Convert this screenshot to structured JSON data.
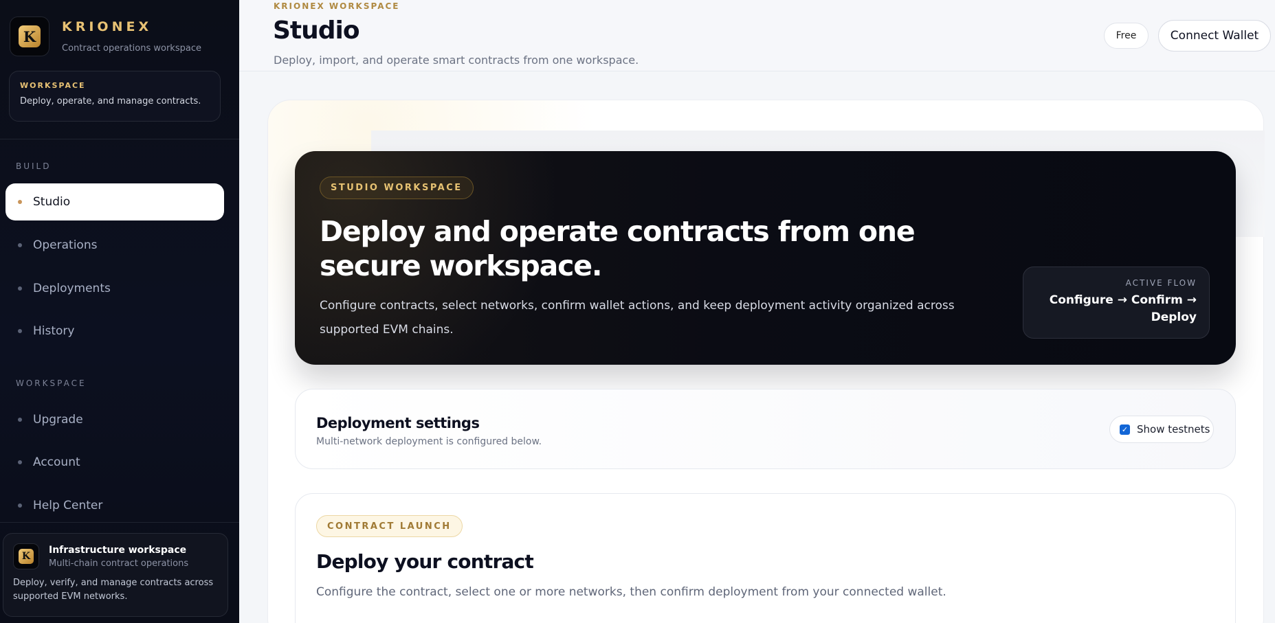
{
  "sidebar": {
    "brand": {
      "logo_letter": "K",
      "name": "KRIONEX",
      "tagline": "Contract operations workspace"
    },
    "workspace_card": {
      "title": "WORKSPACE",
      "description": "Deploy, operate, and manage contracts."
    },
    "sections": [
      {
        "label": "BUILD",
        "items": [
          {
            "label": "Studio",
            "active": true
          },
          {
            "label": "Operations",
            "active": false
          },
          {
            "label": "Deployments",
            "active": false
          },
          {
            "label": "History",
            "active": false
          }
        ]
      },
      {
        "label": "WORKSPACE",
        "items": [
          {
            "label": "Upgrade",
            "active": false
          },
          {
            "label": "Account",
            "active": false
          },
          {
            "label": "Help Center",
            "active": false
          }
        ]
      }
    ],
    "infra_card": {
      "logo_letter": "K",
      "title": "Infrastructure workspace",
      "subtitle": "Multi-chain contract operations",
      "description": "Deploy, verify, and manage contracts across supported EVM networks."
    }
  },
  "header": {
    "eyebrow": "KRIONEX WORKSPACE",
    "title": "Studio",
    "subtitle": "Deploy, import, and operate smart contracts from one workspace.",
    "plan_badge": "Free",
    "connect_wallet_label": "Connect Wallet"
  },
  "hero": {
    "pill": "STUDIO WORKSPACE",
    "title": "Deploy and operate contracts from one secure workspace.",
    "description": "Configure contracts, select networks, confirm wallet actions, and keep deployment activity organized across supported EVM chains.",
    "flow_label": "ACTIVE FLOW",
    "flow_line1": "Configure → Confirm →",
    "flow_line2": "Deploy"
  },
  "settings": {
    "title": "Deployment settings",
    "subtitle": "Multi-network deployment is configured below.",
    "testnets_label": "Show testnets",
    "testnets_checked": true
  },
  "launch": {
    "pill": "CONTRACT LAUNCH",
    "title": "Deploy your contract",
    "description": "Configure the contract, select one or more networks, then confirm deployment from your connected wallet."
  },
  "colors": {
    "accent_gold": "#e8c274",
    "active_dot": "#c9955a",
    "checkbox_blue": "#1266d6",
    "sidebar_bg": "#0b0e18"
  },
  "icons": {
    "brand_logo": "krionex-k-logo-icon",
    "checkbox": "checkmark-icon",
    "nav_bullet": "dot-icon"
  }
}
